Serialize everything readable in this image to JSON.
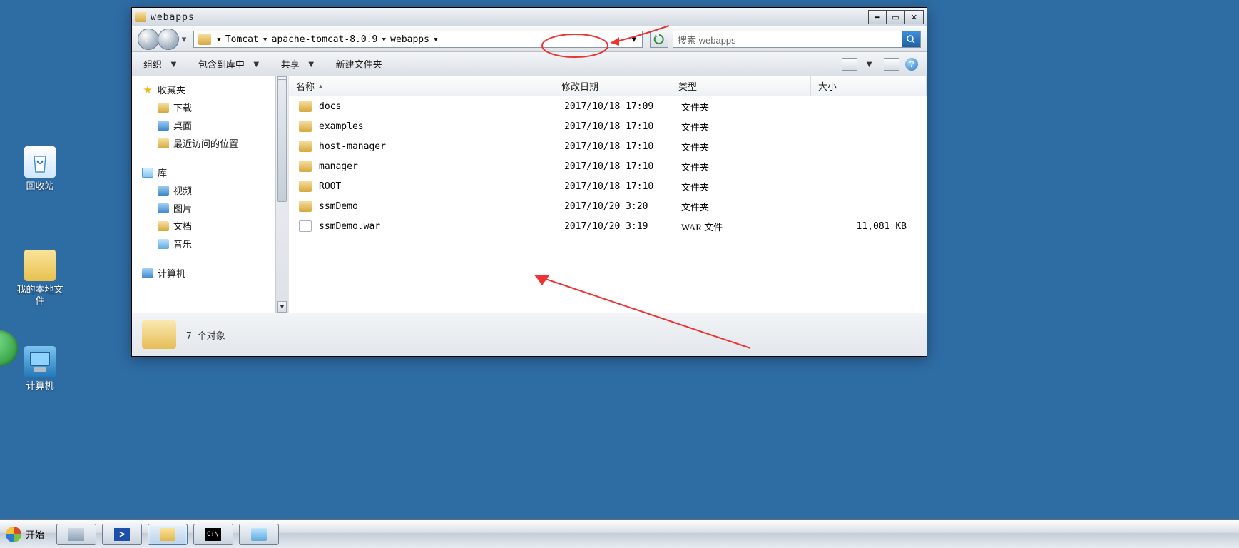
{
  "desktop": {
    "recycle_bin": "回收站",
    "my_files": "我的本地文\n件",
    "computer": "计算机"
  },
  "taskbar": {
    "start": "开始"
  },
  "window": {
    "title": "webapps",
    "breadcrumb": [
      "Tomcat",
      "apache-tomcat-8.0.9",
      "webapps"
    ],
    "search_placeholder": "搜索 webapps",
    "toolbar": {
      "organize": "组织",
      "include_lib": "包含到库中",
      "share": "共享",
      "new_folder": "新建文件夹"
    },
    "nav_pane": {
      "favorites": "收藏夹",
      "downloads": "下载",
      "desktop": "桌面",
      "recent": "最近访问的位置",
      "libraries": "库",
      "videos": "视频",
      "pictures": "图片",
      "documents": "文档",
      "music": "音乐",
      "computer": "计算机"
    },
    "columns": {
      "name": "名称",
      "date": "修改日期",
      "type": "类型",
      "size": "大小"
    },
    "rows": [
      {
        "icon": "folder",
        "name": "docs",
        "date": "2017/10/18 17:09",
        "type": "文件夹",
        "size": ""
      },
      {
        "icon": "folder",
        "name": "examples",
        "date": "2017/10/18 17:10",
        "type": "文件夹",
        "size": ""
      },
      {
        "icon": "folder",
        "name": "host-manager",
        "date": "2017/10/18 17:10",
        "type": "文件夹",
        "size": ""
      },
      {
        "icon": "folder",
        "name": "manager",
        "date": "2017/10/18 17:10",
        "type": "文件夹",
        "size": ""
      },
      {
        "icon": "folder",
        "name": "ROOT",
        "date": "2017/10/18 17:10",
        "type": "文件夹",
        "size": ""
      },
      {
        "icon": "folder",
        "name": "ssmDemo",
        "date": "2017/10/20 3:20",
        "type": "文件夹",
        "size": ""
      },
      {
        "icon": "file",
        "name": "ssmDemo.war",
        "date": "2017/10/20 3:19",
        "type": "WAR 文件",
        "size": "11,081 KB"
      }
    ],
    "status": "7 个对象"
  }
}
